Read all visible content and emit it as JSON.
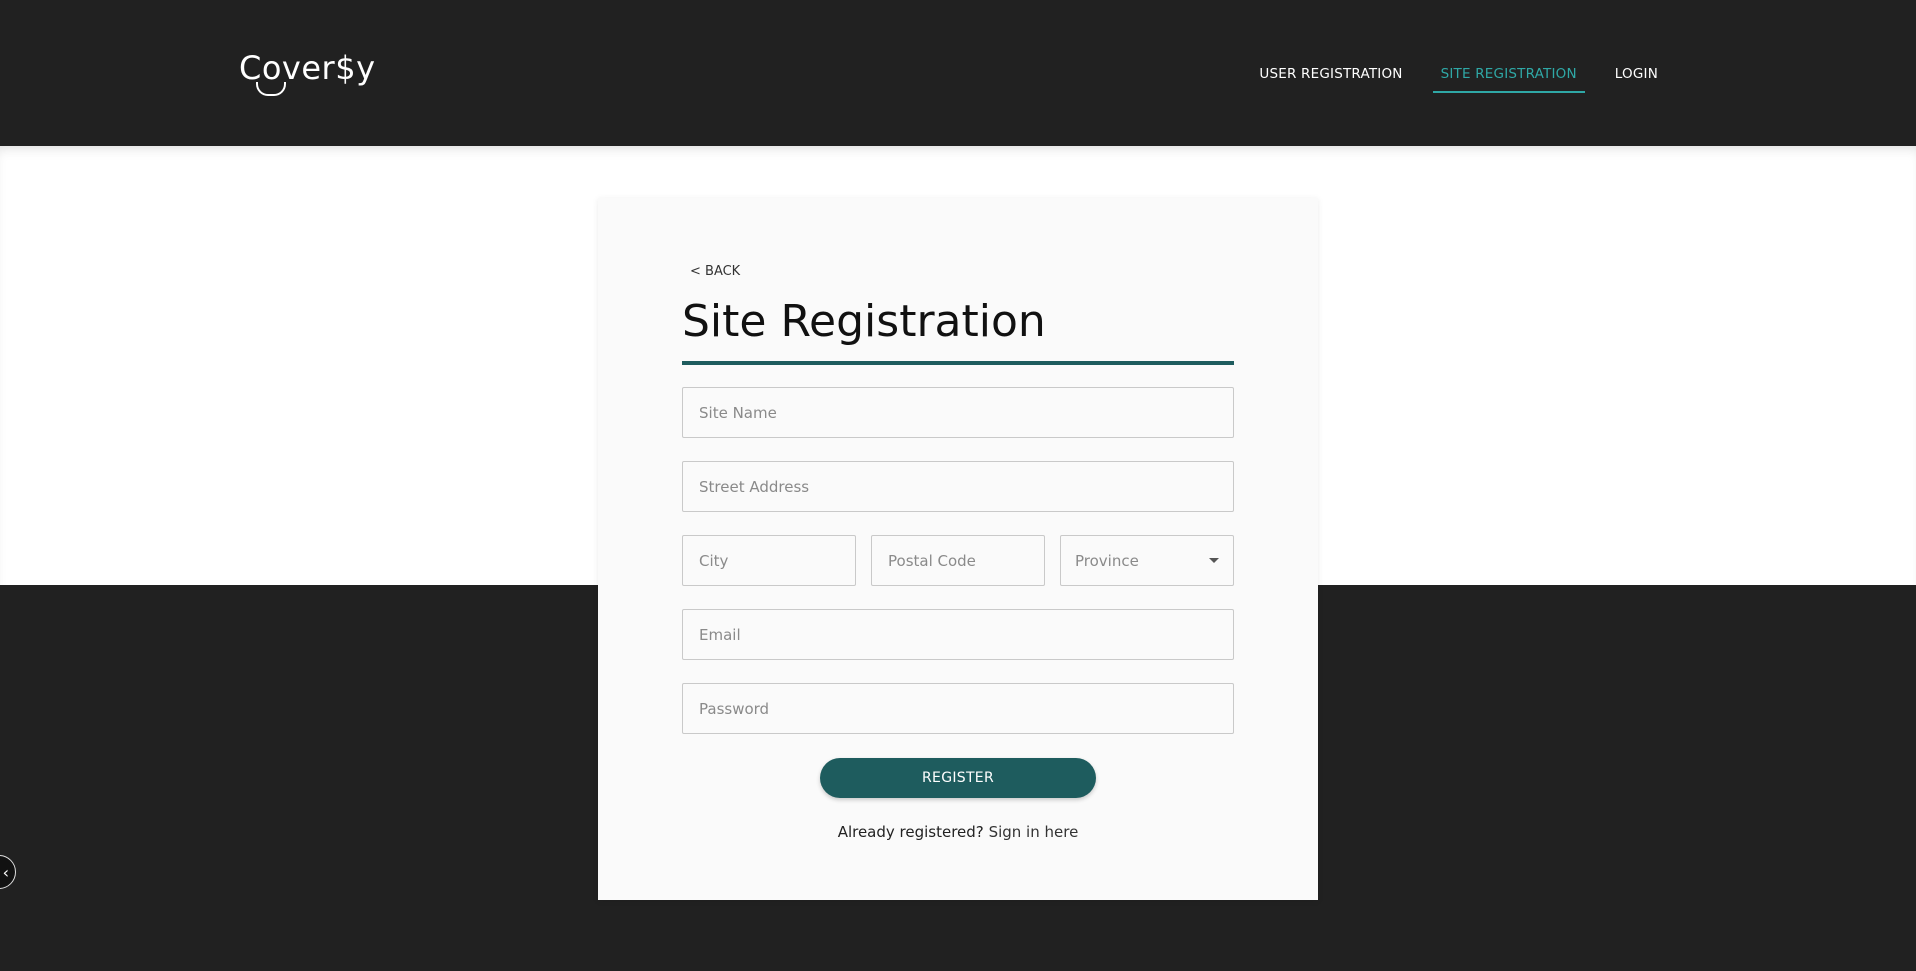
{
  "brand": {
    "logo_text": "Cover$y"
  },
  "nav": {
    "items": [
      {
        "label": "USER REGISTRATION",
        "active": false
      },
      {
        "label": "SITE REGISTRATION",
        "active": true
      },
      {
        "label": "LOGIN",
        "active": false
      }
    ]
  },
  "form": {
    "back_label": "< BACK",
    "title": "Site Registration",
    "site_name_placeholder": "Site Name",
    "street_address_placeholder": "Street Address",
    "city_placeholder": "City",
    "postal_code_placeholder": "Postal Code",
    "province_value": "Province",
    "email_placeholder": "Email",
    "password_placeholder": "Password",
    "register_label": "REGISTER",
    "already_registered_text": "Already registered?",
    "sign_in_link": "Sign in here"
  },
  "colors": {
    "header_bg": "#212121",
    "accent": "#1e5c5e",
    "nav_active": "#2fa8a6"
  },
  "floating_button_icon": "chevron-left-icon",
  "floating_button_glyph": "‹"
}
